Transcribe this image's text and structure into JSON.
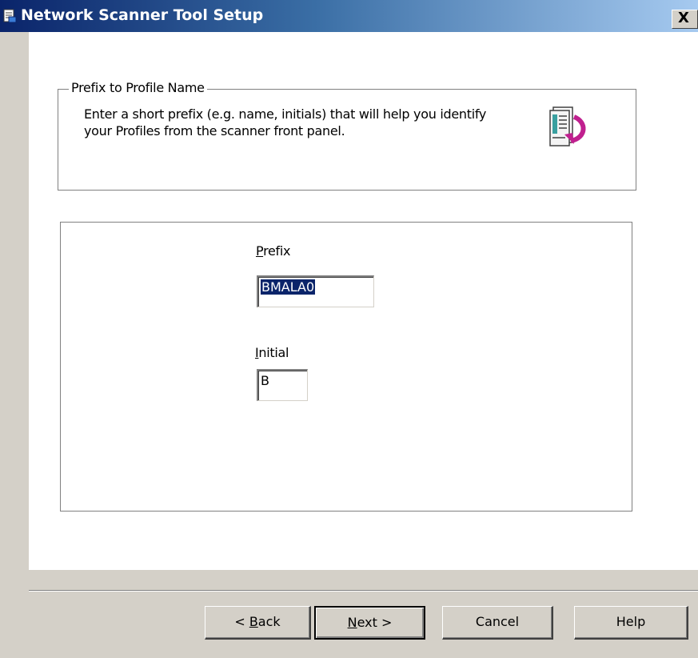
{
  "window": {
    "title": "Network Scanner Tool Setup",
    "title_icon": "setup-icon",
    "close_label": "X",
    "titlebar_colors": [
      "#0a246a",
      "#a6caf0"
    ]
  },
  "group": {
    "legend": "Prefix to Profile Name",
    "description": "Enter a short prefix (e.g. name, initials) that will help you identify your Profiles from the scanner front panel.",
    "icon": "document-arrow-icon"
  },
  "fields": {
    "prefix": {
      "label_mnemonic": "P",
      "label_rest": "refix",
      "value": "BMALA0"
    },
    "initial": {
      "label_mnemonic": "I",
      "label_rest": "nitial",
      "value": "B"
    }
  },
  "buttons": {
    "back_pre": "< ",
    "back_mnemonic": "B",
    "back_rest": "ack",
    "next_mnemonic": "N",
    "next_rest": "ext >",
    "cancel": "Cancel",
    "help": "Help"
  }
}
